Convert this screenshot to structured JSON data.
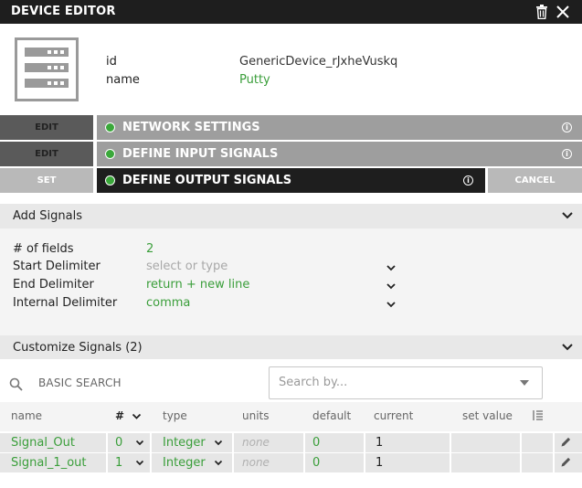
{
  "titlebar": {
    "title": "DEVICE EDITOR"
  },
  "device": {
    "id_label": "id",
    "id_value": "GenericDevice_rJxheVuskq",
    "name_label": "name",
    "name_value": "Putty"
  },
  "steps": [
    {
      "button": "EDIT",
      "label": "NETWORK SETTINGS",
      "info": "i"
    },
    {
      "button": "EDIT",
      "label": "DEFINE INPUT SIGNALS",
      "info": "i"
    },
    {
      "button": "SET",
      "label": "DEFINE OUTPUT SIGNALS",
      "info": "i",
      "cancel": "CANCEL"
    }
  ],
  "add_signals": {
    "title": "Add Signals",
    "fields": [
      {
        "label": "# of fields",
        "value": "2"
      },
      {
        "label": "Start Delimiter",
        "value": "select or type"
      },
      {
        "label": "End Delimiter",
        "value": "return + new line"
      },
      {
        "label": "Internal Delimiter",
        "value": "comma"
      }
    ]
  },
  "customize": {
    "title": "Customize Signals (2)",
    "basic_search": "BASIC SEARCH",
    "search_placeholder": "Search by..."
  },
  "table": {
    "headers": [
      "name",
      "#",
      "type",
      "units",
      "default",
      "current",
      "set value"
    ],
    "rows": [
      {
        "name": "Signal_Out",
        "num": "0",
        "type": "Integer",
        "units": "none",
        "default": "0",
        "current": "1",
        "set_value": ""
      },
      {
        "name": "Signal_1_out",
        "num": "1",
        "type": "Integer",
        "units": "none",
        "default": "0",
        "current": "1",
        "set_value": ""
      }
    ]
  },
  "colors": {
    "accent_green": "#3a9e3a",
    "header_dark": "#1e1e1e",
    "step_grey": "#9e9e9e"
  }
}
